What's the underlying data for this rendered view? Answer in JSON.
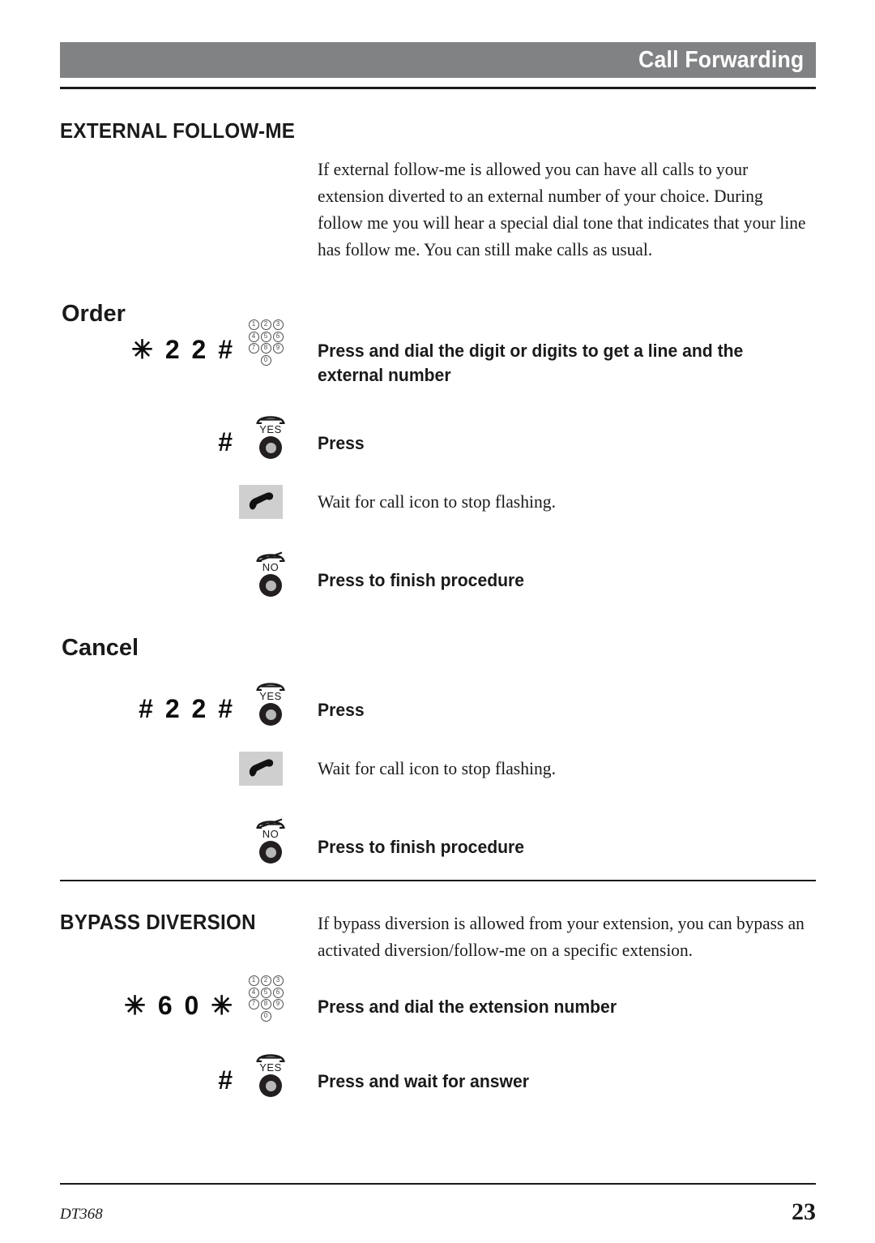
{
  "header": {
    "title": "Call Forwarding"
  },
  "sections": {
    "external_follow_me": {
      "heading": "EXTERNAL FOLLOW-ME",
      "description": "If external follow-me is allowed you can have all calls to your extension diverted to an external number of your choice. During follow me you will hear a special dial tone that indicates that your line has follow me. You can still make calls as usual.",
      "order": {
        "heading": "Order",
        "steps": [
          {
            "code": "✳ 2 2 #",
            "icon": "keypad-icon",
            "instruction": "Press and dial the digit or digits to get a line and the external number"
          },
          {
            "code": "#",
            "icon": "yes-button-icon",
            "icon_label": "YES",
            "instruction": "Press"
          },
          {
            "code": "",
            "icon": "call-handset-icon",
            "instruction": "Wait for call icon to stop flashing."
          },
          {
            "code": "",
            "icon": "no-button-icon",
            "icon_label": "NO",
            "instruction": "Press to finish procedure"
          }
        ]
      },
      "cancel": {
        "heading": "Cancel",
        "steps": [
          {
            "code": "# 2 2 #",
            "icon": "yes-button-icon",
            "icon_label": "YES",
            "instruction": "Press"
          },
          {
            "code": "",
            "icon": "call-handset-icon",
            "instruction": "Wait for call icon to stop flashing."
          },
          {
            "code": "",
            "icon": "no-button-icon",
            "icon_label": "NO",
            "instruction": "Press to finish procedure"
          }
        ]
      }
    },
    "bypass_diversion": {
      "heading": "BYPASS DIVERSION",
      "description": "If bypass diversion is allowed from your extension, you can bypass an activated diversion/follow-me on a specific extension.",
      "steps": [
        {
          "code": "✳ 6 0 ✳",
          "icon": "keypad-icon",
          "instruction": "Press and dial the extension number"
        },
        {
          "code": "#",
          "icon": "yes-button-icon",
          "icon_label": "YES",
          "instruction": "Press and wait for answer"
        }
      ]
    }
  },
  "keypad": {
    "rows": [
      [
        "1",
        "2",
        "3"
      ],
      [
        "4",
        "5",
        "6"
      ],
      [
        "7",
        "8",
        "9"
      ]
    ],
    "zero": "0"
  },
  "footer": {
    "model": "DT368",
    "page_number": "23"
  },
  "colors": {
    "header_bar": "#808284",
    "header_text": "#ffffff",
    "text": "#1a1a1a",
    "call_icon_bg": "#cfcfcf",
    "knob": "#231f20"
  }
}
